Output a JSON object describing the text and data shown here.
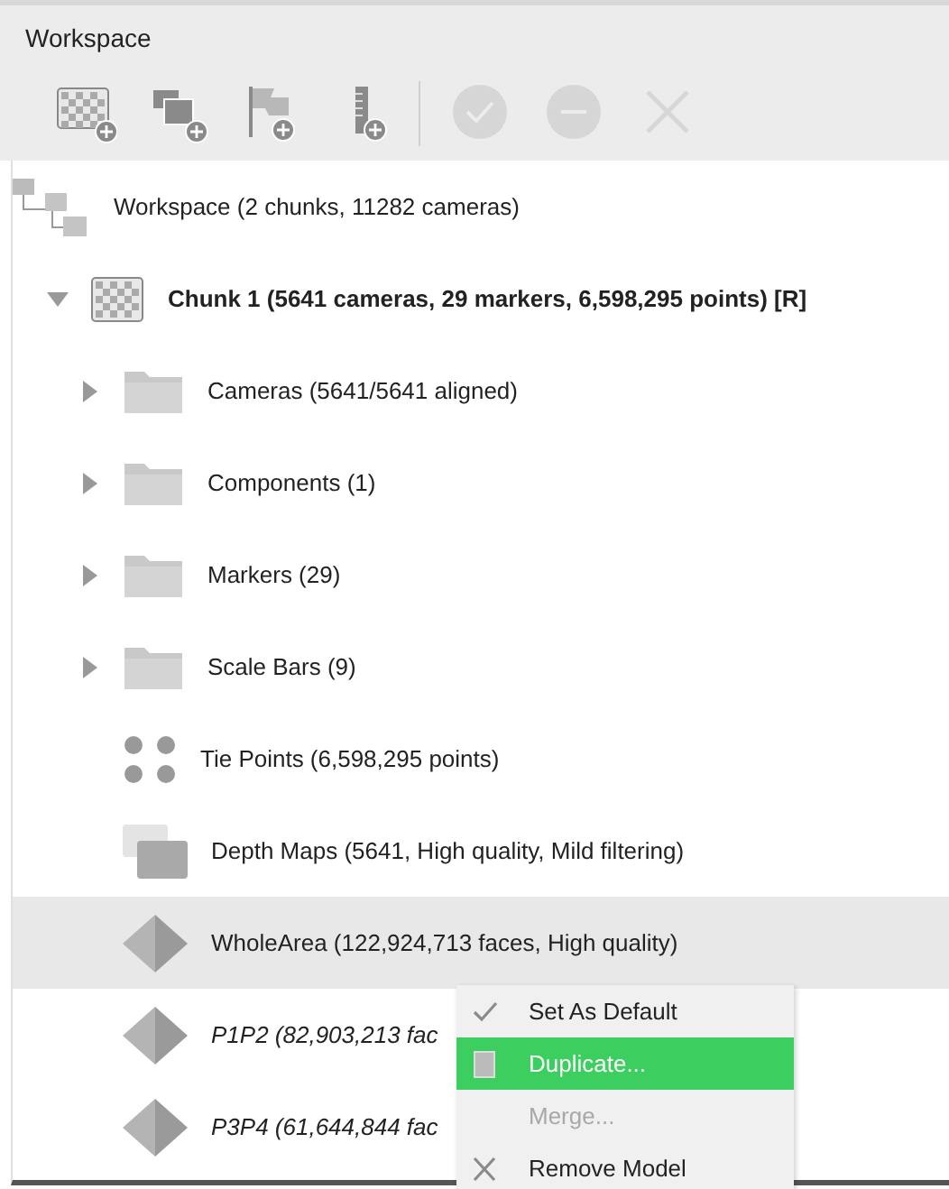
{
  "panel": {
    "title": "Workspace"
  },
  "toolbar": [
    {
      "kind": "add-chunk",
      "disabled": false
    },
    {
      "kind": "add-photos",
      "disabled": false
    },
    {
      "kind": "add-marker",
      "disabled": false
    },
    {
      "kind": "add-scalebar",
      "disabled": false
    },
    {
      "kind": "check",
      "disabled": true
    },
    {
      "kind": "minus",
      "disabled": true
    },
    {
      "kind": "close",
      "disabled": true
    }
  ],
  "tree": [
    {
      "kind": "workspace",
      "label": "Workspace (2 chunks, 11282 cameras)",
      "children": [
        {
          "kind": "chunk",
          "label": "Chunk 1 (5641 cameras, 29 markers, 6,598,295 points) [R]",
          "expanded": true,
          "bold": true,
          "children": [
            {
              "kind": "folder",
              "label": "Cameras (5641/5641 aligned)",
              "expanded": false,
              "selected": false
            },
            {
              "kind": "folder",
              "label": "Components (1)",
              "expanded": false,
              "selected": false
            },
            {
              "kind": "folder",
              "label": "Markers (29)",
              "expanded": false,
              "selected": false
            },
            {
              "kind": "folder",
              "label": "Scale Bars (9)",
              "expanded": false,
              "selected": false
            },
            {
              "kind": "tie-points",
              "label": "Tie Points (6,598,295 points)",
              "selected": false
            },
            {
              "kind": "depth-maps",
              "label": "Depth Maps (5641, High quality, Mild filtering)",
              "selected": false
            },
            {
              "kind": "model",
              "label": "WholeArea (122,924,713 faces, High quality)",
              "italic": false,
              "selected": true
            },
            {
              "kind": "model",
              "label": "P1P2 (82,903,213 fac",
              "italic": true,
              "selected": false
            },
            {
              "kind": "model",
              "label": "P3P4 (61,644,844 fac",
              "italic": true,
              "selected": false
            }
          ]
        }
      ]
    }
  ],
  "context_menu": [
    {
      "kind": "check",
      "label": "Set As Default",
      "selected": false,
      "disabled": false
    },
    {
      "kind": "copy",
      "label": "Duplicate...",
      "selected": true,
      "disabled": false
    },
    {
      "kind": "plain",
      "label": "Merge...",
      "selected": false,
      "disabled": true
    },
    {
      "kind": "remove",
      "label": "Remove Model",
      "selected": false,
      "disabled": false
    }
  ]
}
